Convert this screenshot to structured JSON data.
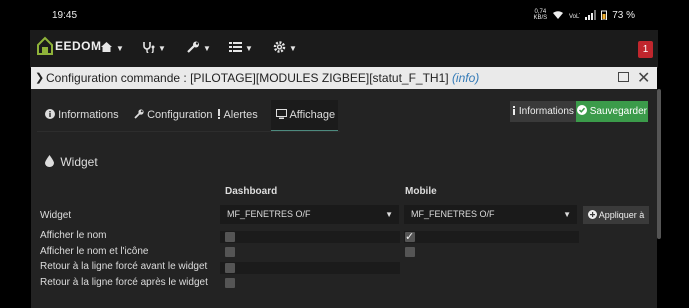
{
  "status": {
    "time": "19:45",
    "net_rate_top": "0,74",
    "net_rate_bottom": "KB/S",
    "battery": "73 %"
  },
  "nav": {
    "logo_text": "EEDOM",
    "notifications": "1"
  },
  "modal": {
    "title": "Configuration commande : [PILOTAGE][MODULES ZIGBEE][statut_F_TH1]",
    "info_link": "(info)"
  },
  "tabs": [
    {
      "label": "Informations"
    },
    {
      "label": "Configuration"
    },
    {
      "label": "Alertes"
    },
    {
      "label": "Affichage"
    }
  ],
  "actions": {
    "info_label": "Informations",
    "save_label": "Sauvegarder"
  },
  "section_title": "Widget",
  "columns": {
    "dashboard": "Dashboard",
    "mobile": "Mobile"
  },
  "widget_row": {
    "label": "Widget",
    "dashboard_value": "MF_FENETRES O/F",
    "mobile_value": "MF_FENETRES O/F",
    "apply_label": "Appliquer à"
  },
  "rows": [
    {
      "label": "Afficher le nom",
      "dashboard_checked": false,
      "mobile_checked": true
    },
    {
      "label": "Afficher le nom et l'icône",
      "dashboard_checked": false,
      "mobile_checked": false
    },
    {
      "label": "Retour à la ligne forcé avant le widget",
      "dashboard_checked": false
    },
    {
      "label": "Retour à la ligne forcé après le widget",
      "dashboard_checked": false
    }
  ],
  "colors": {
    "save_green": "#3b9b4a",
    "notif_red": "#c0262d",
    "info_link_blue": "#337ab7"
  }
}
